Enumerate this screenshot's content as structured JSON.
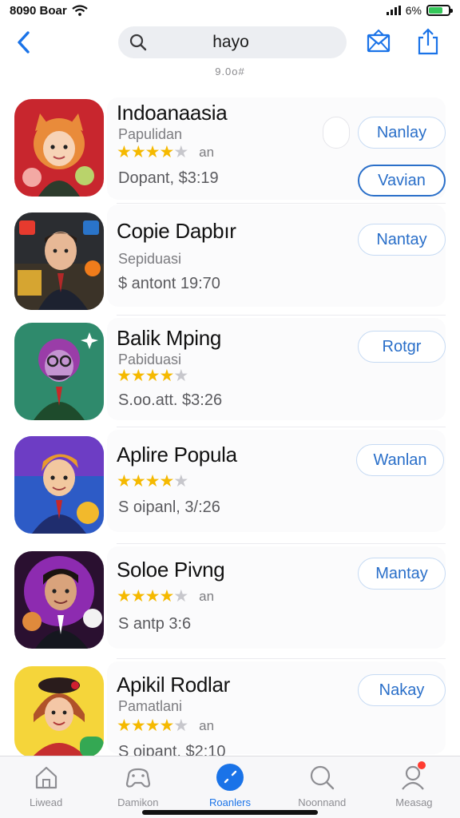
{
  "status": {
    "time": "8090 Boar",
    "battery_text": "6%"
  },
  "nav": {
    "search_text": "hayo",
    "caption": "9.0o#"
  },
  "apps": [
    {
      "name": "Indoanaasia",
      "category": "Papulidan",
      "rating": 4,
      "rating_suffix": "an",
      "price": "Dopant, $3:19",
      "button": "Nanlay",
      "second_button": "Vavian"
    },
    {
      "name": "Copie Dapbır",
      "category": "Sepiduasi",
      "rating": null,
      "rating_suffix": "",
      "price": "$ antont 19:70",
      "button": "Nantay"
    },
    {
      "name": "Balik Mping",
      "category": "Pabiduasi",
      "rating": 4,
      "rating_suffix": "",
      "price": "S.oo.att. $3:26",
      "button": "Rotgr"
    },
    {
      "name": "Aplire Popula",
      "category": "",
      "rating": 4,
      "rating_suffix": "",
      "price": "S oipanl, 3/:26",
      "button": "Wanlan"
    },
    {
      "name": "Soloe Pivng",
      "category": "",
      "rating": 4,
      "rating_suffix": "an",
      "price": "S antp 3:6",
      "button": "Mantay"
    },
    {
      "name": "Apikil Rodlar",
      "category": "Pamatlani",
      "rating": 4,
      "rating_suffix": "an",
      "price": "S oipant, $2:10",
      "button": "Nakay"
    }
  ],
  "tabs": [
    {
      "label": "Liwead",
      "icon": "home-icon"
    },
    {
      "label": "Damikon",
      "icon": "games-icon"
    },
    {
      "label": "Roanlers",
      "icon": "compass-icon",
      "active": true
    },
    {
      "label": "Noonnand",
      "icon": "search-icon"
    },
    {
      "label": "Measag",
      "icon": "account-icon",
      "badge": true
    }
  ],
  "colors": {
    "accent": "#1a73e8",
    "button_text": "#2a6fc9",
    "star": "#f5b900",
    "battery": "#34c759"
  }
}
